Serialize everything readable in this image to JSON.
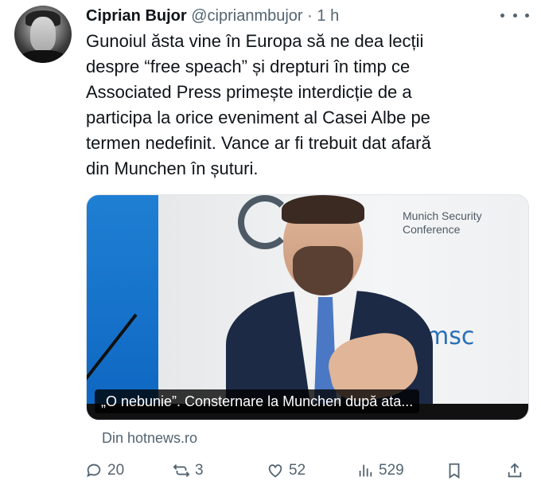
{
  "author": {
    "name": "Ciprian Bujor",
    "handle": "@ciprianmbujor",
    "separator": "·",
    "time": "1 h"
  },
  "tweet": {
    "text_lines": [
      "Gunoiul ăsta vine în Europa să ne dea lecții",
      "despre “free speach” și drepturi în timp ce",
      "Associated Press primește interdicție de a",
      "participa la orice eveniment al Casei Albe pe",
      "termen nedefinit. Vance ar fi trebuit dat afară",
      "din Munchen în șuturi."
    ]
  },
  "media": {
    "caption": "„O nebunie”. Consternare la Munchen după ata...",
    "backdrop_text": "Munich Security\nConference",
    "backdrop_logo": "msc",
    "source": "Din hotnews.ro"
  },
  "actions": {
    "reply": {
      "icon": "reply-icon",
      "count": "20"
    },
    "repost": {
      "icon": "repost-icon",
      "count": "3"
    },
    "like": {
      "icon": "heart-icon",
      "count": "52"
    },
    "views": {
      "icon": "views-icon",
      "count": "529"
    },
    "bookmark": {
      "icon": "bookmark-icon"
    },
    "share": {
      "icon": "share-icon"
    }
  },
  "colors": {
    "text": "#0f1419",
    "secondary": "#536471",
    "accent_blue": "#1f7fd2"
  }
}
